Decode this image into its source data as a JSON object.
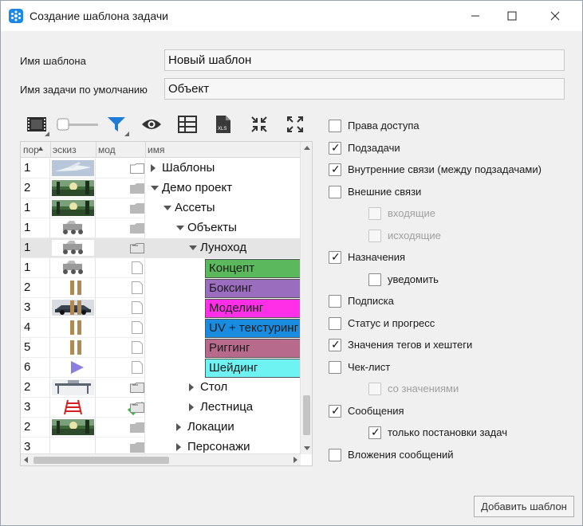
{
  "window": {
    "title": "Создание шаблона задачи",
    "controls": [
      "minimize",
      "maximize",
      "close"
    ]
  },
  "form": {
    "template_name_label": "Имя шаблона",
    "template_name_value": "Новый шаблон",
    "default_task_label": "Имя задачи по умолчанию",
    "default_task_value": "Объект"
  },
  "toolbar": {
    "items": [
      "film-icon",
      "size-slider",
      "filter-icon",
      "eye-icon",
      "grid-icon",
      "xls-icon",
      "collapse-icon",
      "expand-icon"
    ]
  },
  "tree": {
    "columns": [
      "пор",
      "эскиз",
      "мод",
      "имя"
    ],
    "rows": [
      {
        "num": "1",
        "thumb": "plane",
        "mod": "folder-outline",
        "name": "Шаблоны",
        "level": 0,
        "expander": "right"
      },
      {
        "num": "2",
        "thumb": "forest",
        "mod": "folder",
        "name": "Демо проект",
        "level": 0,
        "expander": "down"
      },
      {
        "num": "1",
        "thumb": "forest",
        "mod": "folder",
        "name": "Ассеты",
        "level": 1,
        "expander": "down"
      },
      {
        "num": "1",
        "thumb": "rover",
        "mod": "folder",
        "name": "Объекты",
        "level": 2,
        "expander": "down"
      },
      {
        "num": "1",
        "thumb": "rover",
        "mod": "folder-open",
        "name": "Луноход",
        "level": 3,
        "expander": "down",
        "selected": true
      },
      {
        "num": "1",
        "thumb": "rover",
        "mod": "doc",
        "name": "Концепт",
        "level": 4,
        "task_color": "#5cb85c"
      },
      {
        "num": "2",
        "thumb": "",
        "mod": "doc-bars",
        "name": "Боксинг",
        "level": 4,
        "task_color": "#9b6dbf"
      },
      {
        "num": "3",
        "thumb": "car",
        "mod": "doc-bars",
        "name": "Моделинг",
        "level": 4,
        "task_color": "#ff2fe8"
      },
      {
        "num": "4",
        "thumb": "",
        "mod": "doc-bars",
        "name": "UV + текстуринг",
        "level": 4,
        "task_color": "#1a8ce0"
      },
      {
        "num": "5",
        "thumb": "",
        "mod": "doc-bars",
        "name": "Риггинг",
        "level": 4,
        "task_color": "#b86a8c"
      },
      {
        "num": "6",
        "thumb": "",
        "mod": "doc-play",
        "name": "Шейдинг",
        "level": 4,
        "task_color": "#6ff2f2"
      },
      {
        "num": "2",
        "thumb": "table",
        "mod": "folder-open",
        "name": "Стол",
        "level": 3,
        "expander": "right"
      },
      {
        "num": "3",
        "thumb": "ladder",
        "mod": "folder-check",
        "name": "Лестница",
        "level": 3,
        "expander": "right"
      },
      {
        "num": "2",
        "thumb": "forest",
        "mod": "folder",
        "name": "Локации",
        "level": 2,
        "expander": "right"
      },
      {
        "num": "3",
        "thumb": "",
        "mod": "folder",
        "name": "Персонажи",
        "level": 2,
        "expander": "right"
      }
    ]
  },
  "options": [
    {
      "label": "Права доступа",
      "checked": false,
      "enabled": true,
      "indent": 0
    },
    {
      "label": "Подзадачи",
      "checked": true,
      "enabled": true,
      "indent": 0
    },
    {
      "label": "Внутренние связи (между подзадачами)",
      "checked": true,
      "enabled": true,
      "indent": 0
    },
    {
      "label": "Внешние связи",
      "checked": false,
      "enabled": true,
      "indent": 0
    },
    {
      "label": "входящие",
      "checked": false,
      "enabled": false,
      "indent": 1
    },
    {
      "label": "исходящие",
      "checked": false,
      "enabled": false,
      "indent": 1
    },
    {
      "label": "Назначения",
      "checked": true,
      "enabled": true,
      "indent": 0
    },
    {
      "label": "уведомить",
      "checked": false,
      "enabled": true,
      "indent": 1
    },
    {
      "label": "Подписка",
      "checked": false,
      "enabled": true,
      "indent": 0
    },
    {
      "label": "Статус и прогресс",
      "checked": false,
      "enabled": true,
      "indent": 0
    },
    {
      "label": "Значения тегов и хештеги",
      "checked": true,
      "enabled": true,
      "indent": 0
    },
    {
      "label": "Чек-лист",
      "checked": false,
      "enabled": true,
      "indent": 0
    },
    {
      "label": "со значениями",
      "checked": false,
      "enabled": false,
      "indent": 1
    },
    {
      "label": "Сообщения",
      "checked": true,
      "enabled": true,
      "indent": 0
    },
    {
      "label": "только постановки задач",
      "checked": true,
      "enabled": true,
      "indent": 1
    },
    {
      "label": "Вложения сообщений",
      "checked": false,
      "enabled": true,
      "indent": 0
    }
  ],
  "buttons": {
    "add_template": "Добавить шаблон"
  },
  "colors": {
    "accent": "#1e88e5",
    "filter_icon": "#1e7bd6",
    "check_green": "#3ab54a",
    "mod_bar": "#b08a52",
    "play_icon": "#8a7fe0"
  }
}
